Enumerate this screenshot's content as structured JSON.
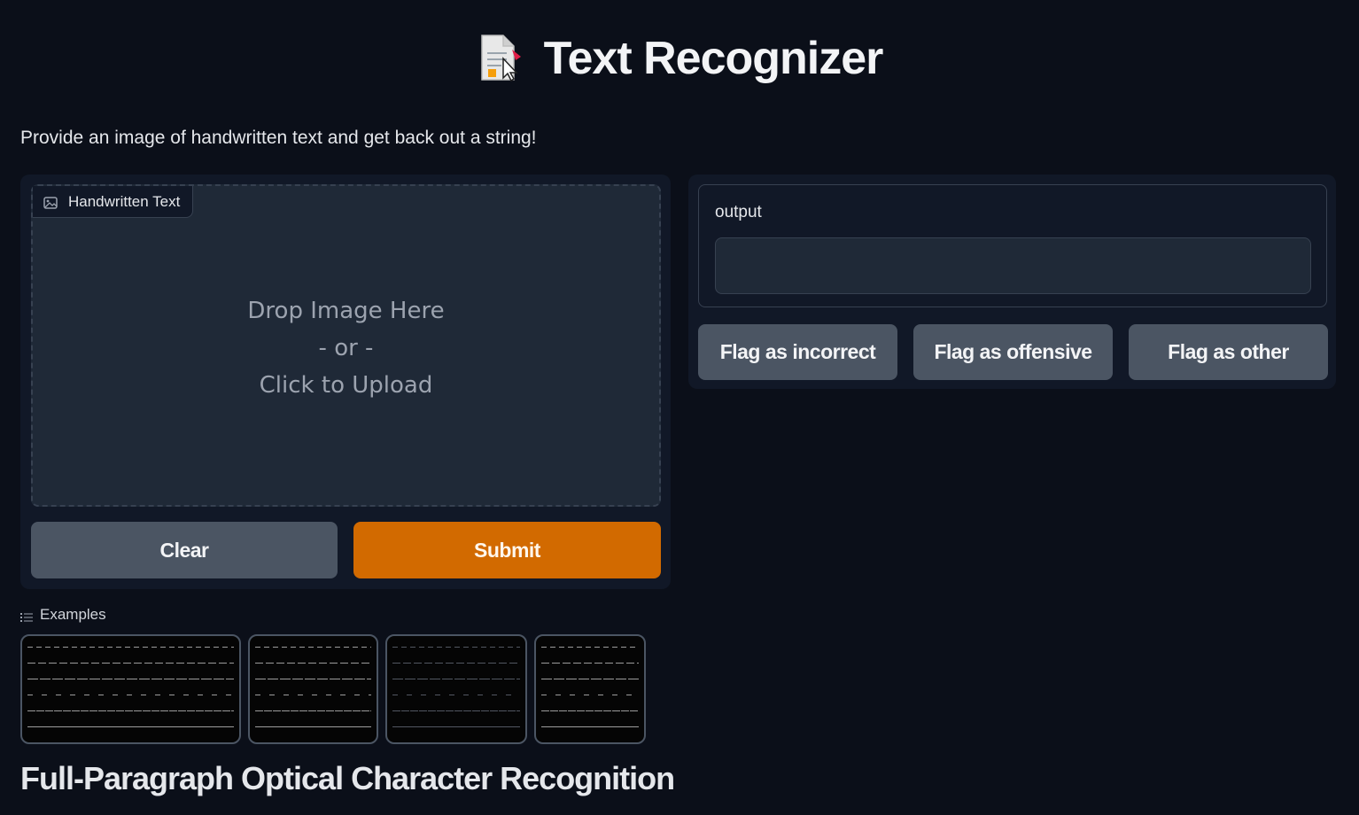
{
  "header": {
    "title": "Text Recognizer",
    "icon": "document-with-cursor-icon"
  },
  "description": "Provide an image of handwritten text and get back out a string!",
  "input": {
    "label": "Handwritten Text",
    "drop_line1": "Drop Image Here",
    "drop_line2": "- or -",
    "drop_line3": "Click to Upload"
  },
  "buttons": {
    "clear": "Clear",
    "submit": "Submit"
  },
  "output": {
    "label": "output",
    "value": ""
  },
  "flags": {
    "incorrect": "Flag as incorrect",
    "offensive": "Flag as offensive",
    "other": "Flag as other"
  },
  "examples": {
    "label": "Examples",
    "count": 4
  },
  "footer_heading": "Full-Paragraph Optical Character Recognition",
  "colors": {
    "background": "#0b0f19",
    "panel": "#111827",
    "submit": "#d26a00",
    "secondary_button": "#4b5563"
  }
}
